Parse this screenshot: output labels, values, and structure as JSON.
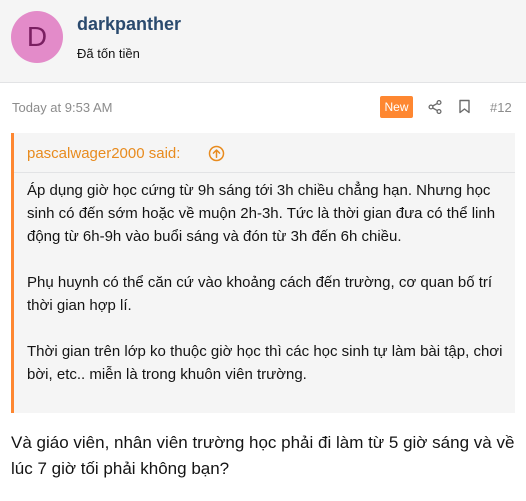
{
  "user": {
    "avatar_letter": "D",
    "name": "darkpanther",
    "title": "Đã tốn tiền"
  },
  "post": {
    "timestamp": "Today at 9:53 AM",
    "new_badge": "New",
    "number": "#12",
    "icons": [
      "share-icon",
      "bookmark-icon"
    ]
  },
  "quote": {
    "author": "pascalwager2000 said:",
    "icon": "arrow-up-circle-icon",
    "paragraphs": [
      "Áp dụng giờ học cứng từ 9h sáng tới 3h chiều chẳng hạn. Nhưng học sinh có đến sớm hoặc về muộn 2h-3h. Tức là thời gian đưa có thể linh động từ 6h-9h vào buổi sáng và đón từ 3h đến 6h chiều.",
      "Phụ huynh có thể căn cứ vào khoảng cách đến trường, cơ quan bố trí thời gian hợp lí.",
      "Thời gian trên lớp ko thuộc giờ học thì các học sinh tự làm bài tập, chơi bời, etc.. miễn là trong khuôn viên trường."
    ]
  },
  "reply": "Và giáo viên, nhân viên trường học phải đi làm từ 5 giờ sáng và về lúc 7 giờ tối phải không bạn?",
  "colors": {
    "accent": "#fe8731",
    "quote_author": "#e88b1e",
    "username": "#2a4a6e",
    "avatar_bg": "#e38bc9"
  }
}
